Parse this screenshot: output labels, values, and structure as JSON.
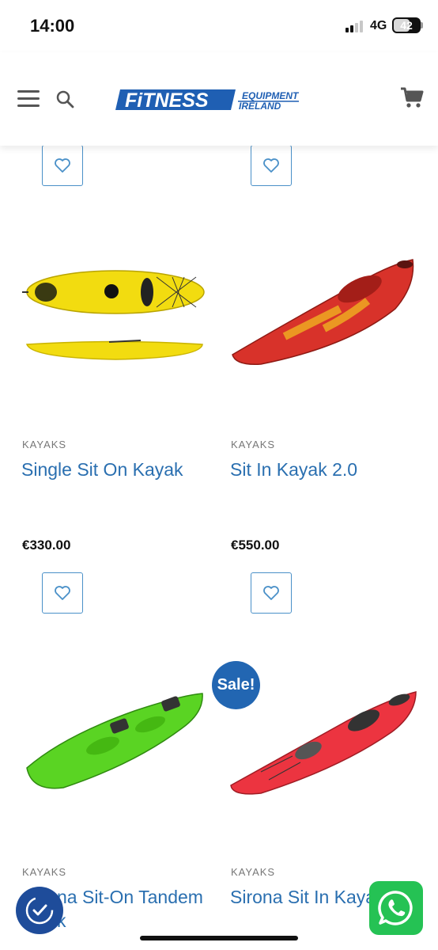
{
  "status_bar": {
    "time": "14:00",
    "network": "4G",
    "battery": "42"
  },
  "header": {
    "logo_main": "FiTNESS",
    "logo_sub_1": "EQUIPMENT",
    "logo_sub_2": "IRELAND",
    "icons": [
      "menu-icon",
      "search-icon",
      "cart-icon"
    ]
  },
  "products": [
    {
      "category": "KAYAKS",
      "title": "Single Sit On Kayak",
      "price": "€330.00",
      "color": "#f2dc10"
    },
    {
      "category": "KAYAKS",
      "title": "Sit In Kayak 2.0",
      "price": "€550.00",
      "color": "#d8322a"
    },
    {
      "category": "KAYAKS",
      "title": "na Sit-On Tandem",
      "title_line2": "k",
      "color": "#5ad423"
    },
    {
      "category": "KAYAKS",
      "title": "Sirona Sit In Kaya",
      "color": "#ec3440",
      "badge": "Sale!"
    }
  ],
  "colors": {
    "accent": "#2a6fb0",
    "badge": "#2266b2",
    "whatsapp": "#25c254"
  }
}
